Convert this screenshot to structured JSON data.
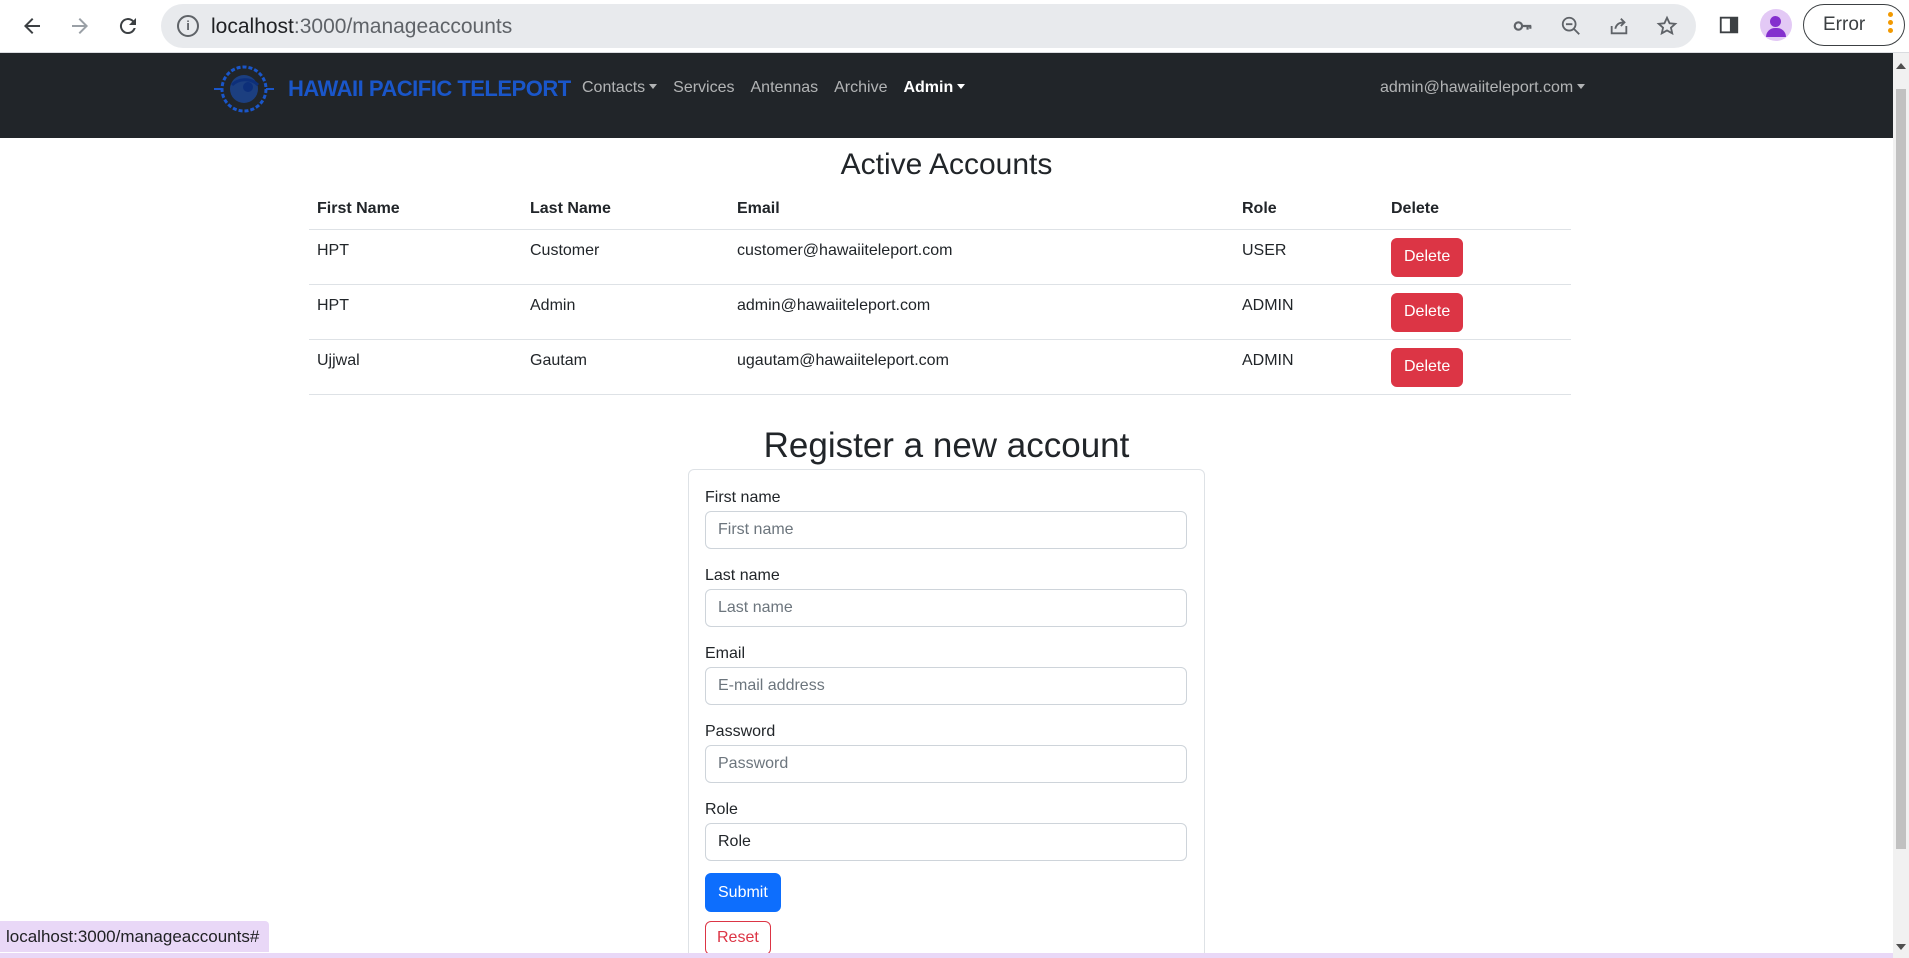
{
  "browser": {
    "url_host": "localhost",
    "url_path": ":3000/manageaccounts",
    "error_label": "Error",
    "status_url": "localhost:3000/manageaccounts#"
  },
  "navbar": {
    "brand": "HAWAII PACIFIC TELEPORT",
    "items": [
      {
        "label": "Contacts",
        "dropdown": true
      },
      {
        "label": "Services",
        "dropdown": false
      },
      {
        "label": "Antennas",
        "dropdown": false
      },
      {
        "label": "Archive",
        "dropdown": false
      },
      {
        "label": "Admin",
        "dropdown": true
      }
    ],
    "user": "admin@hawaiiteleport.com"
  },
  "accounts": {
    "title": "Active Accounts",
    "columns": [
      "First Name",
      "Last Name",
      "Email",
      "Role",
      "Delete"
    ],
    "rows": [
      {
        "first": "HPT",
        "last": "Customer",
        "email": "customer@hawaiiteleport.com",
        "role": "USER",
        "action": "Delete"
      },
      {
        "first": "HPT",
        "last": "Admin",
        "email": "admin@hawaiiteleport.com",
        "role": "ADMIN",
        "action": "Delete"
      },
      {
        "first": "Ujjwal",
        "last": "Gautam",
        "email": "ugautam@hawaiiteleport.com",
        "role": "ADMIN",
        "action": "Delete"
      }
    ]
  },
  "register": {
    "title": "Register a new account",
    "first_label": "First name",
    "first_placeholder": "First name",
    "last_label": "Last name",
    "last_placeholder": "Last name",
    "email_label": "Email",
    "email_placeholder": "E-mail address",
    "password_label": "Password",
    "password_placeholder": "Password",
    "role_label": "Role",
    "role_value": "Role",
    "submit": "Submit",
    "reset": "Reset"
  },
  "colors": {
    "navbar_bg": "#212529",
    "brand": "#1a56c9",
    "danger": "#dc3545",
    "primary": "#0d6efd"
  }
}
